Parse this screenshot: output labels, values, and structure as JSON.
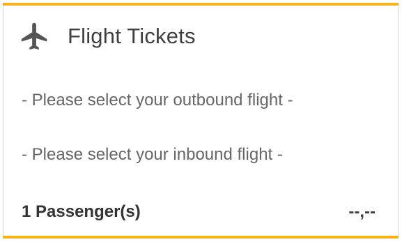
{
  "widget": {
    "icon": "airplane-icon",
    "title": "Flight Tickets",
    "outbound_text": "- Please select your outbound flight -",
    "inbound_text": "- Please select your inbound flight -",
    "passengers_text": "1 Passenger(s)",
    "price_text": "--,--",
    "accent_color": "#f7b21b"
  }
}
